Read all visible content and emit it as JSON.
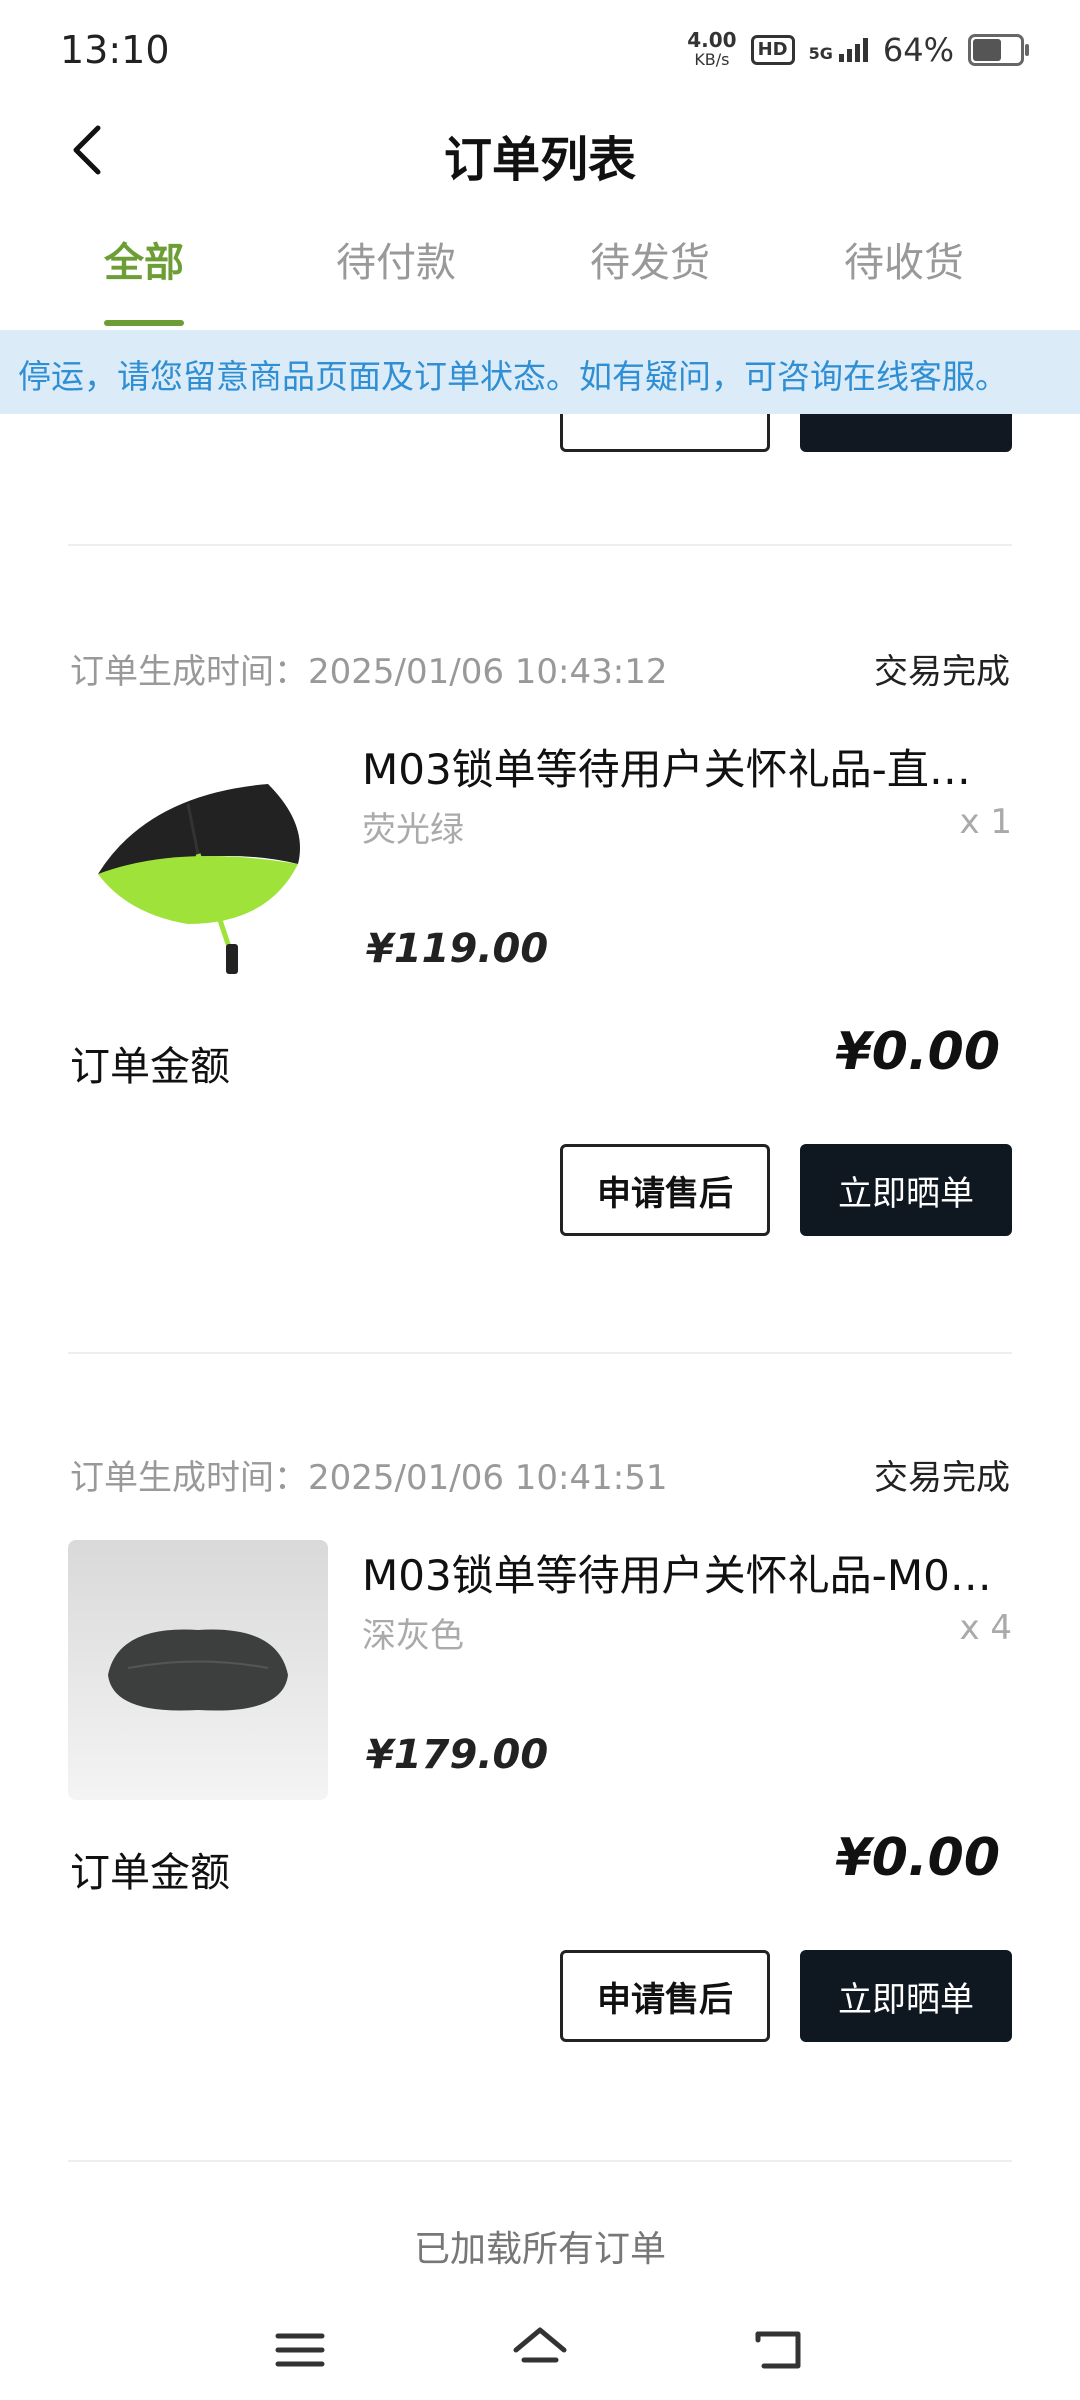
{
  "status_bar": {
    "time": "13:10",
    "net_speed_value": "4.00",
    "net_speed_unit": "KB/s",
    "hd": "HD",
    "signal": "5G",
    "battery_percent": "64%",
    "battery_level": 0.64
  },
  "header": {
    "title": "订单列表"
  },
  "tabs": [
    {
      "label": "全部",
      "active": true
    },
    {
      "label": "待付款",
      "active": false
    },
    {
      "label": "待发货",
      "active": false
    },
    {
      "label": "待收货",
      "active": false
    }
  ],
  "notice": {
    "text": "停运，请您留意商品页面及订单状态。如有疑问，可咨询在线客服。"
  },
  "orders": [
    {
      "time": "订单生成时间：2025/01/06 10:43:12",
      "status": "交易完成",
      "product_title": "M03锁单等待用户关怀礼品-直…",
      "spec": "荧光绿",
      "qty": "x 1",
      "price": "¥119.00",
      "amount_label": "订单金额",
      "amount": "¥0.00",
      "btn_after_sale": "申请售后",
      "btn_share": "立即晒单"
    },
    {
      "time": "订单生成时间：2025/01/06 10:41:51",
      "status": "交易完成",
      "product_title": "M03锁单等待用户关怀礼品-M0…",
      "spec": "深灰色",
      "qty": "x 4",
      "price": "¥179.00",
      "amount_label": "订单金额",
      "amount": "¥0.00",
      "btn_after_sale": "申请售后",
      "btn_share": "立即晒单"
    }
  ],
  "footer": {
    "loaded_text": "已加载所有订单"
  },
  "colors": {
    "accent_green": "#6c9e35",
    "notice_bg": "#dcebf8",
    "notice_text": "#2e8fd4",
    "dark_button": "#0f1720"
  }
}
